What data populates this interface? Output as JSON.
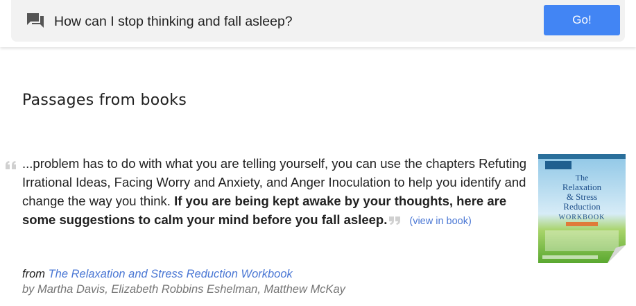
{
  "search": {
    "query": "How can I stop thinking and fall asleep?",
    "icon": "question-answer-icon",
    "go_label": "Go!",
    "accent_color": "#4285f4"
  },
  "section": {
    "title": "Passages from books"
  },
  "passage": {
    "text_plain": "...problem has to do with what you are telling yourself, you can use the chapters Refuting Irrational Ideas, Facing Worry and Anxiety, and Anger Inoculation to help you identify and change the way you think.",
    "text_bold": "If you are being kept awake by your thoughts, here are some suggestions to calm your mind before you fall asleep.",
    "view_link": "(view in book)",
    "open_quote_icon": "open-quote-icon",
    "close_quote_icon": "close-quote-icon"
  },
  "book": {
    "from_label": "from",
    "title": "The Relaxation and Stress Reduction Workbook",
    "authors_line": "by Martha Davis, Elizabeth Robbins Eshelman, Matthew McKay",
    "cover": {
      "title_line1": "The",
      "title_line2": "Relaxation",
      "title_line3": "& Stress",
      "title_line4": "Reduction",
      "title_line5": "WORKBOOK"
    }
  }
}
